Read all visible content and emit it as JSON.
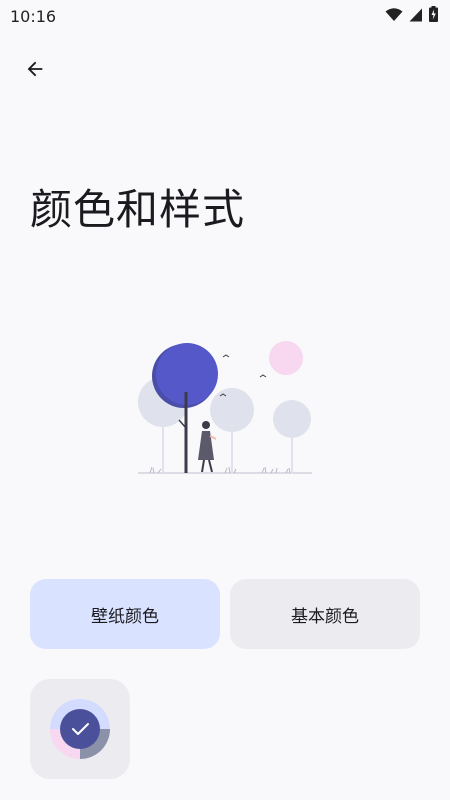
{
  "status_bar": {
    "time": "10:16",
    "icons": [
      "wifi-icon",
      "cellular-signal-icon",
      "battery-charging-icon"
    ]
  },
  "header": {
    "back_icon": "arrow-left-icon"
  },
  "page": {
    "title": "颜色和样式"
  },
  "tabs": [
    {
      "label": "壁纸颜色",
      "selected": true
    },
    {
      "label": "基本颜色",
      "selected": false
    }
  ],
  "palette_options": [
    {
      "name": "wallpaper-palette-1",
      "selected": true,
      "colors": [
        "#4a5099",
        "#d3dbff",
        "#f8d7f0",
        "#8b91a8"
      ]
    }
  ],
  "colors": {
    "background": "#f9f9fb",
    "selected_tab": "#d9e2ff",
    "unselected_tab": "#ececf0",
    "accent": "#5458c8"
  }
}
